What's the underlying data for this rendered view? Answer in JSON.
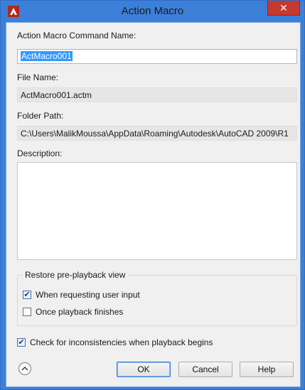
{
  "window": {
    "title": "Action Macro",
    "close_glyph": "✕",
    "app_icon": "autocad-icon"
  },
  "form": {
    "command_name_label": "Action Macro Command Name:",
    "command_name_value": "ActMacro001",
    "file_name_label": "File Name:",
    "file_name_value": "ActMacro001.actm",
    "folder_path_label": "Folder Path:",
    "folder_path_value": "C:\\Users\\MalikMoussa\\AppData\\Roaming\\Autodesk\\AutoCAD 2009\\R1",
    "description_label": "Description:",
    "description_value": ""
  },
  "restore_group": {
    "title": "Restore pre-playback view",
    "options": [
      {
        "label": "When requesting user input",
        "checked": true
      },
      {
        "label": "Once playback finishes",
        "checked": false
      }
    ]
  },
  "consistency_check": {
    "label": "Check for inconsistencies when playback begins",
    "checked": true
  },
  "buttons": {
    "ok": "OK",
    "cancel": "Cancel",
    "help": "Help",
    "collapse_icon": "chevron-up-icon"
  },
  "colors": {
    "titlebar": "#3c7fd8",
    "close_button": "#c7382f",
    "selection": "#3399ff",
    "dialog_background": "#f0f0f0"
  }
}
